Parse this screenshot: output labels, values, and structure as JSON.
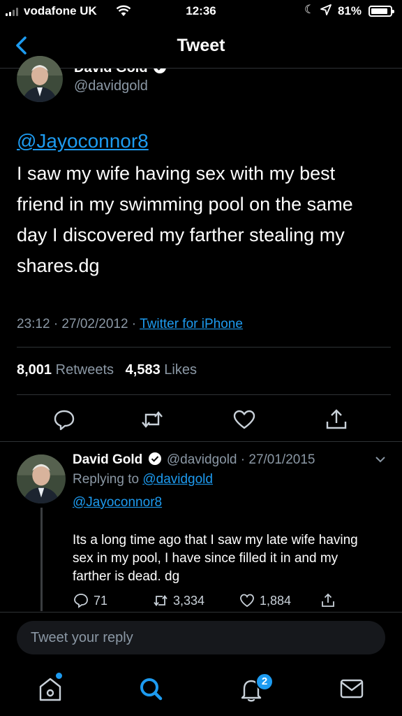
{
  "status_bar": {
    "carrier": "vodafone UK",
    "time": "12:36",
    "battery": "81%"
  },
  "nav": {
    "title": "Tweet"
  },
  "tweet": {
    "author_name": "David Gold",
    "handle": "@davidgold",
    "mention": "@Jayoconnor8",
    "text": "I saw my wife having sex with my best friend in my swimming pool on the same day I discovered my farther stealing my shares.dg",
    "time": "23:12 · 27/02/2012 · ",
    "source": "Twitter for iPhone",
    "retweets_count": "8,001",
    "retweets_label": "Retweets",
    "likes_count": "4,583",
    "likes_label": "Likes"
  },
  "reply": {
    "author_name": "David Gold",
    "handle_date": "@davidgold · 27/01/2015",
    "replying_label": "Replying to ",
    "replying_handle": "@davidgold",
    "mention": "@Jayoconnor8",
    "text": "Its a long time ago that I saw my late wife having sex in my pool, I have since filled it in and my farther is dead. dg",
    "replies": "71",
    "retweets": "3,334",
    "likes": "1,884"
  },
  "composer": {
    "placeholder": "Tweet your reply"
  },
  "tab_bar": {
    "notifications_badge": "2"
  },
  "colors": {
    "accent": "#1d9bf0",
    "background": "#000000",
    "muted": "#8b98a5",
    "divider": "#2f3336"
  }
}
